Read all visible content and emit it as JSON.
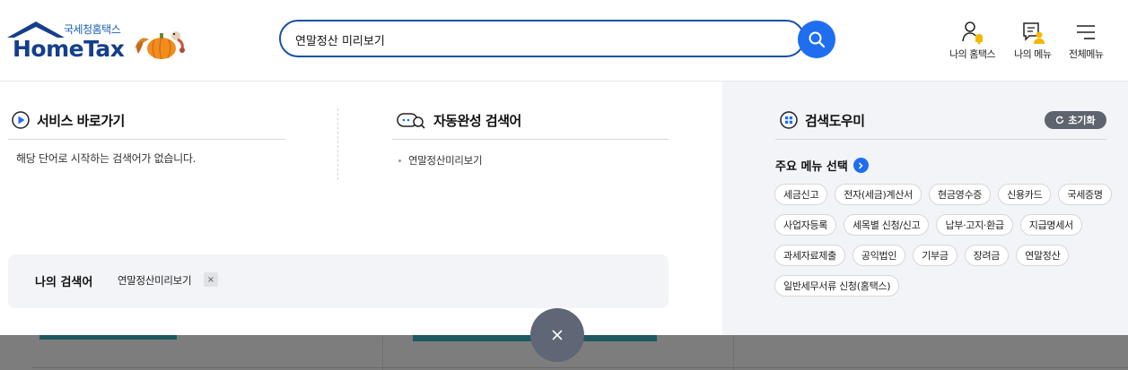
{
  "header": {
    "logo_sub": "국세청홈택스",
    "logo_main": "HomeTax",
    "search": {
      "value": "연말정산 미리보기"
    },
    "util": [
      {
        "label": "나의 홈택스"
      },
      {
        "label": "나의 메뉴"
      },
      {
        "label": "전체메뉴"
      }
    ]
  },
  "service_shortcut": {
    "title": "서비스 바로가기",
    "empty_text": "해당 단어로 시작하는 검색어가 없습니다."
  },
  "autocomplete": {
    "title": "자동완성 검색어",
    "items": [
      "연말정산미리보기"
    ]
  },
  "my_search": {
    "title": "나의 검색어",
    "items": [
      {
        "keyword": "연말정산미리보기",
        "delete": "×"
      }
    ]
  },
  "helper": {
    "title": "검색도우미",
    "reset_label": "초기화",
    "menu_title": "주요 메뉴 선택",
    "chips": [
      "세금신고",
      "전자(세금)계산서",
      "현금영수증",
      "신용카드",
      "국세증명",
      "사업자등록",
      "세목별 신청/신고",
      "납부·고지·환급",
      "지급명세서",
      "과세자료제출",
      "공익법인",
      "기부금",
      "장려금",
      "연말정산",
      "일반세무서류 신청(홈택스)"
    ]
  },
  "close_label": "×",
  "colors": {
    "brand_navy": "#143f8a",
    "search_border": "#1a50a8",
    "accent_blue": "#1f6ef0",
    "helper_bg": "#f2f4f8",
    "overlay_gray": "#7d7d7d"
  }
}
